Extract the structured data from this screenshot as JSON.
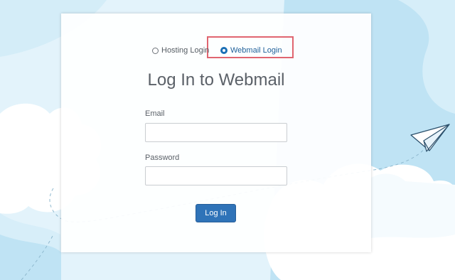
{
  "login_type": {
    "options": [
      {
        "label": "Hosting Login",
        "selected": false
      },
      {
        "label": "Webmail Login",
        "selected": true
      }
    ],
    "highlight_color": "#e06570"
  },
  "form": {
    "title": "Log In to Webmail",
    "email_label": "Email",
    "email_value": "",
    "password_label": "Password",
    "password_value": "",
    "submit_label": "Log In"
  },
  "colors": {
    "accent": "#2f73b8",
    "sky": "#c4e7f6",
    "cloud": "#ffffff"
  },
  "icons": [
    "paper-plane-icon"
  ]
}
